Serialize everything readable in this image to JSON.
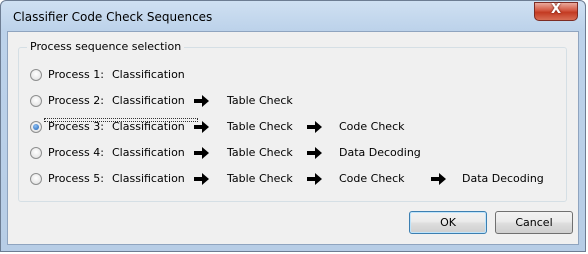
{
  "window": {
    "title": "Classifier Code Check Sequences",
    "close_glyph": "X"
  },
  "group": {
    "legend": "Process sequence selection"
  },
  "processes": [
    {
      "name": "Process 1:",
      "steps": [
        "Classification"
      ],
      "selected": false
    },
    {
      "name": "Process 2:",
      "steps": [
        "Classification",
        "Table Check"
      ],
      "selected": false
    },
    {
      "name": "Process 3:",
      "steps": [
        "Classification",
        "Table Check",
        "Code Check"
      ],
      "selected": true
    },
    {
      "name": "Process 4:",
      "steps": [
        "Classification",
        "Table Check",
        "Data Decoding"
      ],
      "selected": false
    },
    {
      "name": "Process 5:",
      "steps": [
        "Classification",
        "Table Check",
        "Code Check",
        "Data Decoding"
      ],
      "selected": false
    }
  ],
  "buttons": {
    "ok": "OK",
    "cancel": "Cancel"
  },
  "icons": {
    "arrow": "right-arrow-icon",
    "close": "close-icon"
  },
  "colors": {
    "selected_radio": "#1b5fb3",
    "close_button": "#c33a22",
    "title_bar": "#bcd2ea"
  }
}
